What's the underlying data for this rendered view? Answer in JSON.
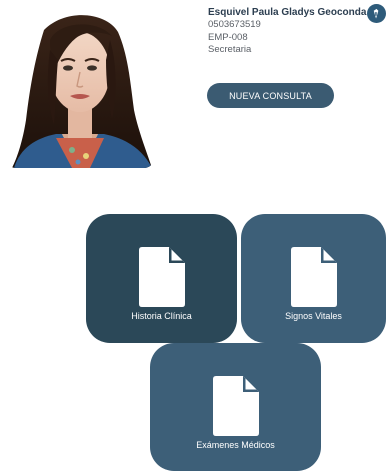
{
  "profile": {
    "name": "Esquivel Paula Gladys Geoconda",
    "phone": "0503673519",
    "employee_code": "EMP-008",
    "role": "Secretaria",
    "edit_icon": "pen-icon",
    "photo_icon": "user-photo"
  },
  "actions": {
    "new_consult_label": "NUEVA CONSULTA"
  },
  "tiles": [
    {
      "label": "Historia Clínica",
      "icon": "document-icon"
    },
    {
      "label": "Signos Vitales",
      "icon": "document-icon"
    },
    {
      "label": "Exámenes Médicos",
      "icon": "document-icon"
    }
  ],
  "colors": {
    "primary": "#3d5f78",
    "primary_dark": "#2b4858",
    "button": "#3b5b72",
    "badge": "#2e5b7a",
    "name_text": "#2c3e50"
  }
}
